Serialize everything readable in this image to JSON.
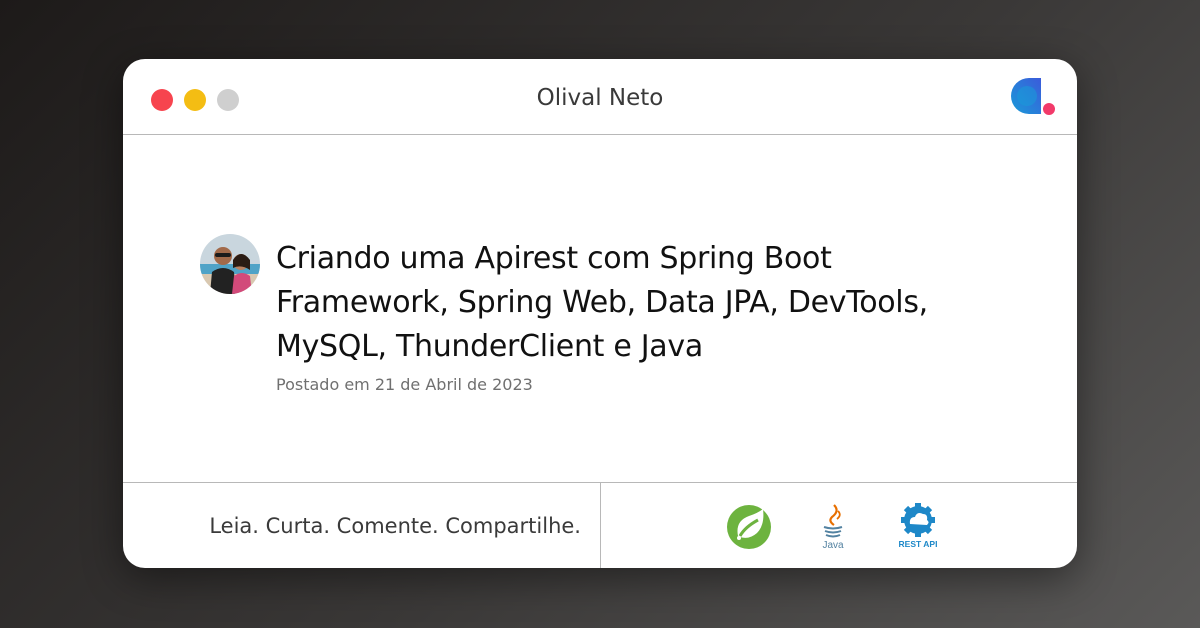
{
  "window": {
    "title": "Olival Neto"
  },
  "post": {
    "title": "Criando uma Apirest com Spring Boot Framework, Spring Web, Data JPA, DevTools, MySQL, ThunderClient e Java",
    "date": "Postado em 21 de Abril de 2023"
  },
  "footer": {
    "tagline": "Leia. Curta. Comente. Compartilhe.",
    "tech_icons": [
      {
        "name": "spring-icon"
      },
      {
        "name": "java-icon",
        "label": "Java"
      },
      {
        "name": "rest-api-icon",
        "label": "REST API"
      }
    ]
  },
  "colors": {
    "dot_red": "#f7444e",
    "dot_yellow": "#f4bd13",
    "dot_gray": "#cfcfcf",
    "spring_green": "#6db33f",
    "java_blue": "#5382a1",
    "java_red": "#e76f00",
    "rest_blue": "#1e88c8",
    "logo_blue": "#2d7bd9",
    "logo_pink": "#f23a6a"
  }
}
